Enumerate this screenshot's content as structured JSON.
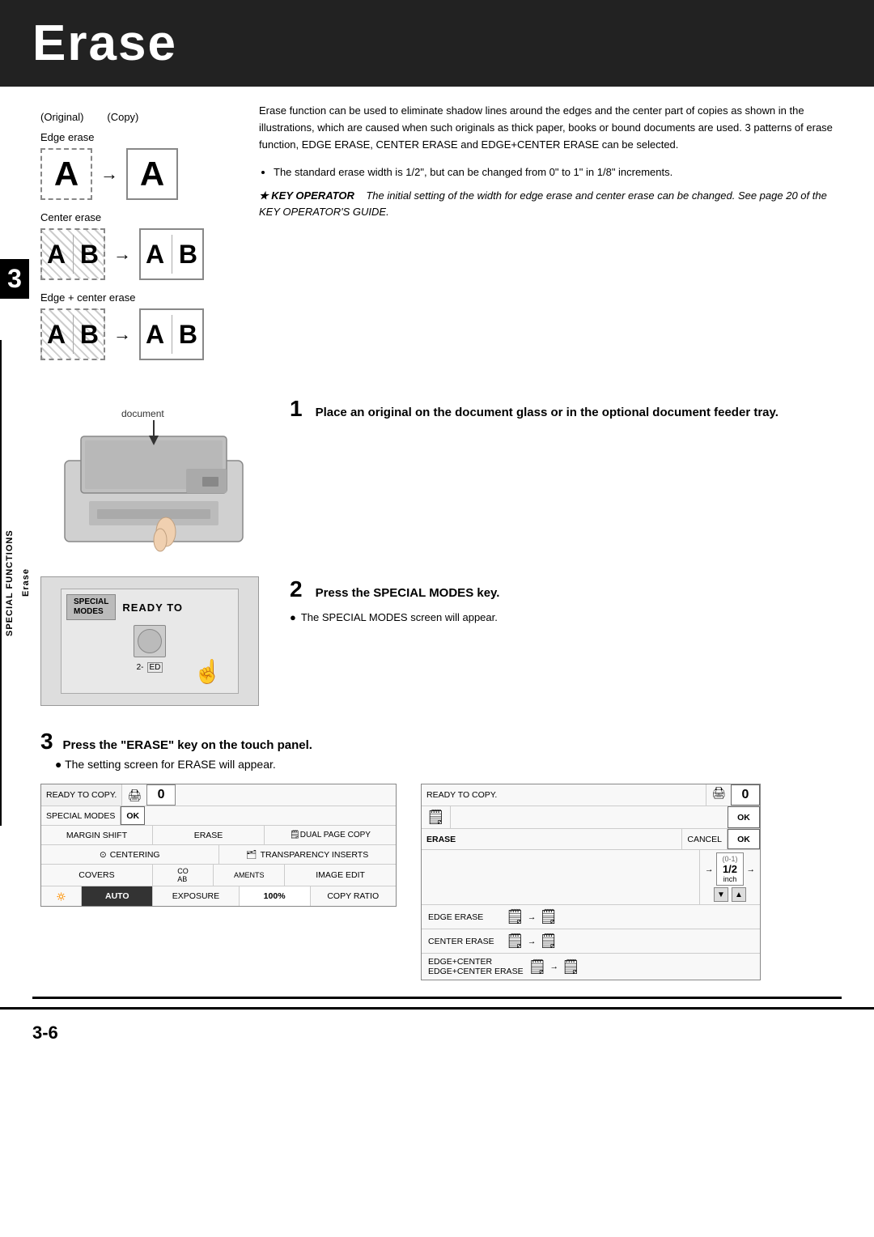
{
  "header": {
    "title": "Erase"
  },
  "chapter": {
    "number": "3",
    "label": "SPECIAL FUNCTIONS",
    "sublabel": "Erase"
  },
  "left_column": {
    "original_label": "(Original)",
    "copy_label": "(Copy)",
    "edge_erase_label": "Edge erase",
    "center_erase_label": "Center erase",
    "edge_center_erase_label": "Edge + center erase"
  },
  "description": {
    "main_text": "Erase function can be used to eliminate shadow lines around the edges and the center part of copies as shown in the illustrations, which are caused when such originals as thick paper, books or bound documents are used. 3 patterns of erase function, EDGE ERASE, CENTER ERASE and EDGE+CENTER ERASE can be selected.",
    "bullet1": "The standard erase width is 1/2\", but can be changed from 0\" to 1\" in 1/8\" increments.",
    "key_operator_note": "★ KEY OPERATOR   The initial setting of the width for edge erase and center erase can be changed. See page 20 of the KEY OPERATOR'S GUIDE."
  },
  "steps": [
    {
      "number": "1",
      "title": "Place an original on the document glass or in the optional document feeder tray."
    },
    {
      "number": "2",
      "title": "Press the SPECIAL MODES key.",
      "bullet": "The SPECIAL MODES screen will appear."
    },
    {
      "number": "3",
      "title": "Press the \"ERASE\" key on the touch panel.",
      "bullet": "The setting screen for ERASE will appear."
    }
  ],
  "panel1": {
    "ready_to_copy": "READY TO COPY.",
    "counter": "0",
    "special_modes_label": "SPECIAL MODES",
    "ok_label": "OK",
    "margin_shift_label": "MARGIN SHIFT",
    "erase_label": "ERASE",
    "dual_page_copy_label": "DUAL PAGE COPY",
    "centering_label": "CENTERING",
    "transparency_inserts_label": "TRANSPARENCY INSERTS",
    "covers_label": "COVERS",
    "aments_label": "AMENTS",
    "image_edit_label": "IMAGE EDIT",
    "auto_label": "AUTO",
    "exposure_label": "EXPOSURE",
    "copy_ratio_label": "COPY RATIO",
    "percent": "100%"
  },
  "panel2": {
    "ready_to_copy": "READY TO COPY.",
    "counter": "0",
    "ok_label": "OK",
    "erase_label": "ERASE",
    "cancel_label": "CANCEL",
    "edge_erase_label": "EDGE ERASE",
    "center_erase_label": "CENTER ERASE",
    "edge_center_erase_label": "EDGE+CENTER ERASE",
    "fraction_num": "1/2",
    "fraction_unit": "inch",
    "fraction_range": "(0-1)"
  },
  "special_modes_key": {
    "label": "SPECIAL MODES",
    "ready_to": "READY TO",
    "special_io": "SPECIAL MODES"
  },
  "footer": {
    "page_number": "3-6"
  },
  "icons": {
    "document_icon": "📄",
    "arrow_right": "→",
    "down_arrow": "▼",
    "up_arrow": "▲"
  }
}
